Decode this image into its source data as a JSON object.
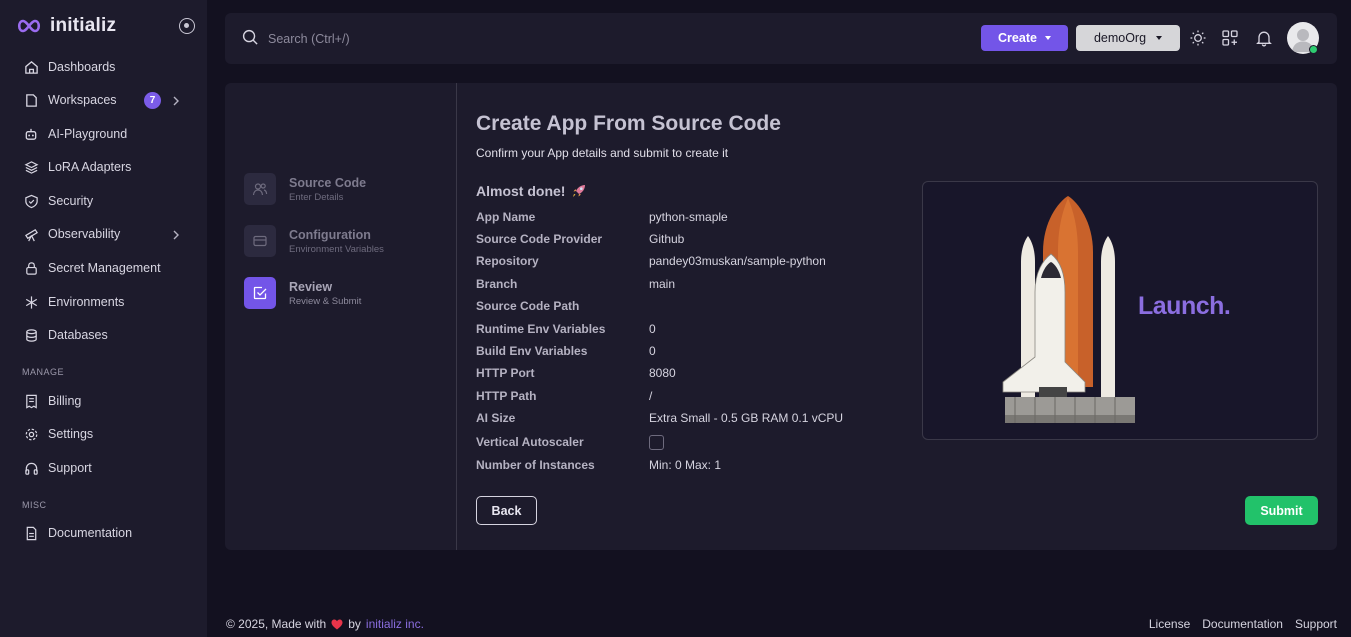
{
  "brand": {
    "name": "initializ"
  },
  "sidebar": {
    "items": [
      {
        "label": "Dashboards",
        "icon": "home-icon"
      },
      {
        "label": "Workspaces",
        "icon": "briefcase-icon",
        "badge": "7"
      },
      {
        "label": "AI-Playground",
        "icon": "robot-icon"
      },
      {
        "label": "LoRA Adapters",
        "icon": "layers-icon"
      },
      {
        "label": "Security",
        "icon": "shield-icon"
      },
      {
        "label": "Observability",
        "icon": "telescope-icon"
      },
      {
        "label": "Secret Management",
        "icon": "lock-icon"
      },
      {
        "label": "Environments",
        "icon": "snowflake-icon"
      },
      {
        "label": "Databases",
        "icon": "database-icon"
      }
    ],
    "manage_label": "MANAGE",
    "manage_items": [
      {
        "label": "Billing",
        "icon": "receipt-icon"
      },
      {
        "label": "Settings",
        "icon": "gear-icon"
      },
      {
        "label": "Support",
        "icon": "headphones-icon"
      }
    ],
    "misc_label": "MISC",
    "misc_items": [
      {
        "label": "Documentation",
        "icon": "document-icon"
      }
    ]
  },
  "topbar": {
    "search_placeholder": "Search (Ctrl+/)",
    "create_label": "Create",
    "org_label": "demoOrg"
  },
  "steps": [
    {
      "title": "Source Code",
      "subtitle": "Enter Details"
    },
    {
      "title": "Configuration",
      "subtitle": "Environment Variables"
    },
    {
      "title": "Review",
      "subtitle": "Review & Submit"
    }
  ],
  "main": {
    "title": "Create App From Source Code",
    "subtitle": "Confirm your App details and submit to create it",
    "almost_done": "Almost done!",
    "details": [
      {
        "label": "App Name",
        "value": "python-smaple"
      },
      {
        "label": "Source Code Provider",
        "value": "Github"
      },
      {
        "label": "Repository",
        "value": "pandey03muskan/sample-python"
      },
      {
        "label": "Branch",
        "value": "main"
      },
      {
        "label": "Source Code Path",
        "value": ""
      },
      {
        "label": "Runtime Env Variables",
        "value": "0"
      },
      {
        "label": "Build Env Variables",
        "value": "0"
      },
      {
        "label": "HTTP Port",
        "value": "8080"
      },
      {
        "label": "HTTP Path",
        "value": "/"
      },
      {
        "label": "AI Size",
        "value": "Extra Small - 0.5 GB RAM 0.1 vCPU"
      },
      {
        "label": "Vertical Autoscaler",
        "value": ""
      },
      {
        "label": "Number of Instances",
        "value": "Min: 0 Max: 1"
      }
    ],
    "launch_text": "Launch.",
    "back_label": "Back",
    "submit_label": "Submit"
  },
  "footer": {
    "prefix": "© 2025, Made with",
    "by": "by",
    "company": "initializ inc.",
    "links": [
      "License",
      "Documentation",
      "Support"
    ]
  },
  "colors": {
    "accent": "#7355e8",
    "success": "#22c26a",
    "background": "#131120",
    "panel": "#1d1b2c"
  }
}
